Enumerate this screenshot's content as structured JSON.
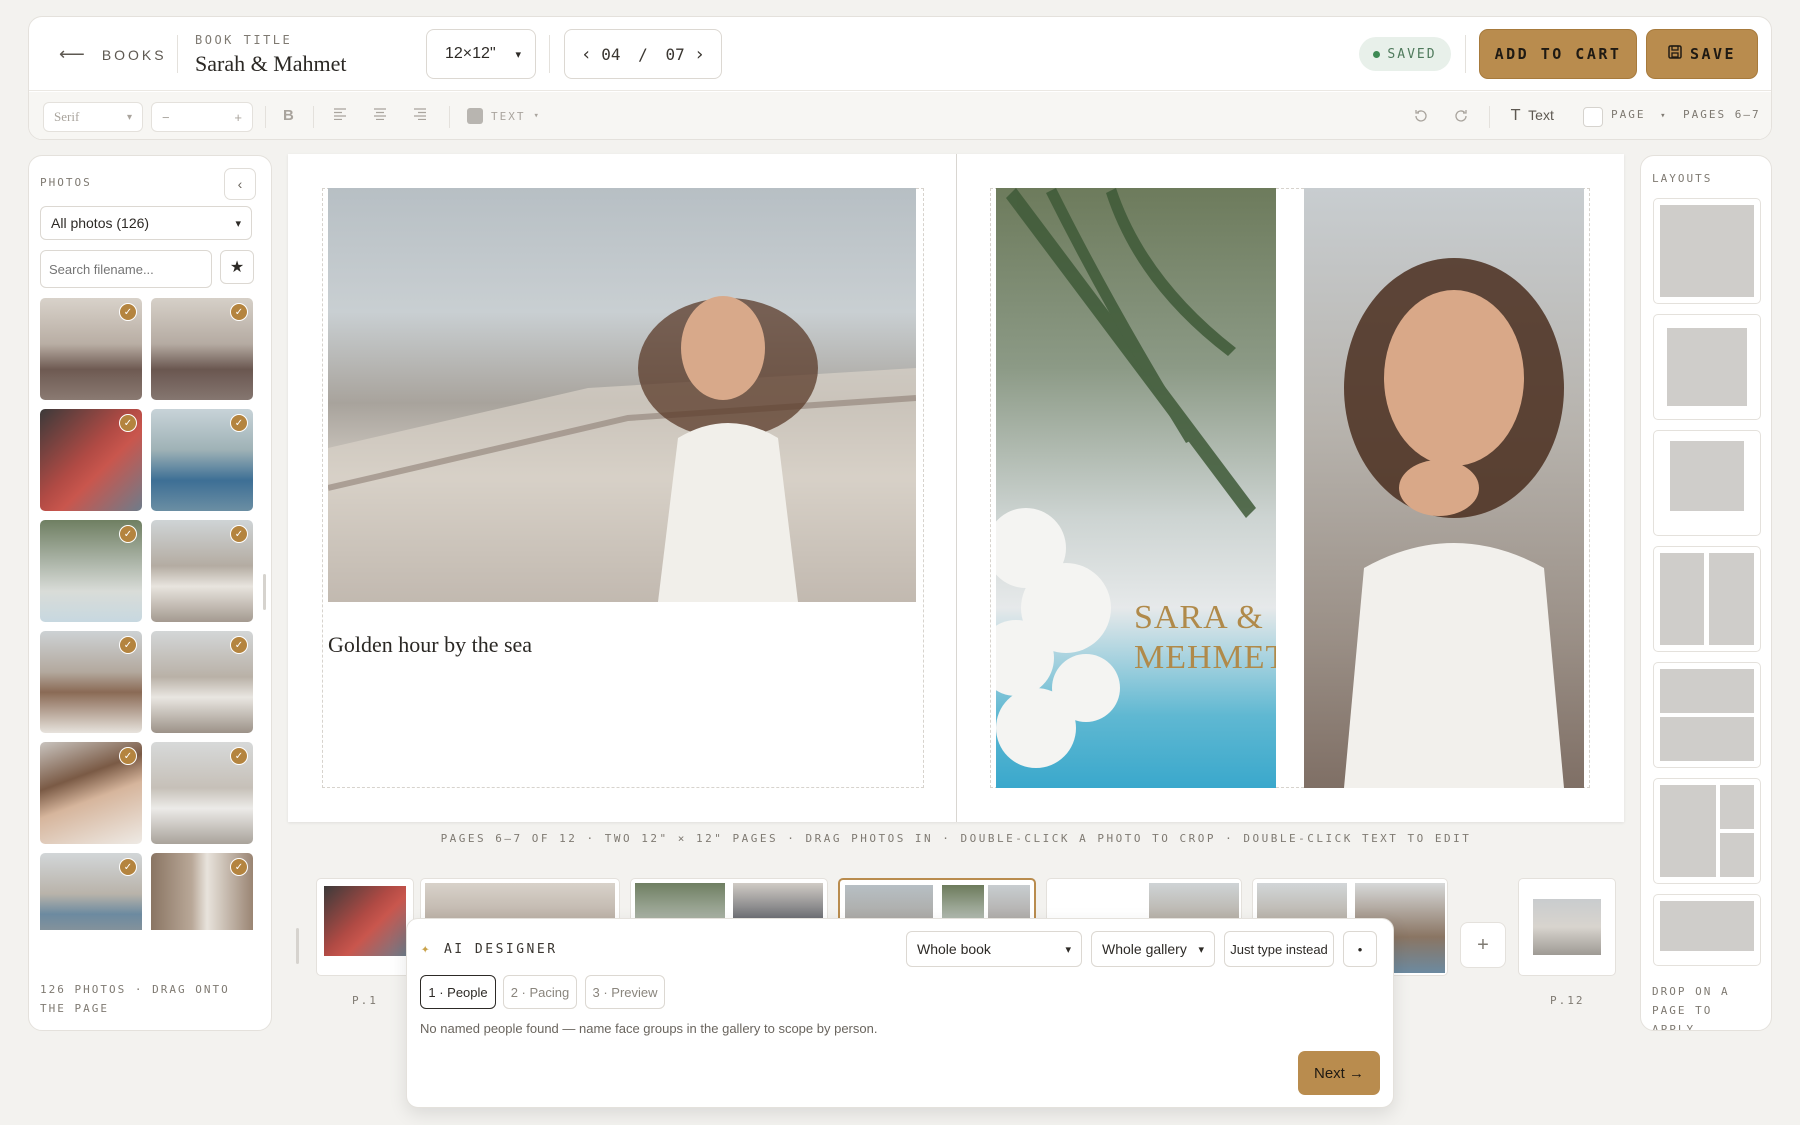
{
  "header": {
    "back_label": "BOOKS",
    "book_title_label": "BOOK TITLE",
    "book_title": "Sarah & Mahmet",
    "size_value": "12×12\"",
    "page_current": "04",
    "page_sep": "/",
    "page_total": "07",
    "saved_label": "SAVED",
    "add_to_cart": "ADD TO CART",
    "save": "SAVE"
  },
  "toolbar": {
    "font_value": "Serif",
    "size_minus": "−",
    "size_plus": "+",
    "bold": "B",
    "text_color_label": "TEXT",
    "text_button": "Text",
    "page_label": "PAGE",
    "pages_label": "PAGES 6–7"
  },
  "photos_panel": {
    "title": "PHOTOS",
    "filter_value": "All photos (126)",
    "search_placeholder": "Search filename...",
    "footer": "126 PHOTOS · DRAG ONTO THE PAGE"
  },
  "canvas": {
    "caption": "Golden hour by the sea",
    "sign_text": "SARA & MEHMET",
    "info": "PAGES 6–7 OF 12 · TWO 12\" × 12\" PAGES · DRAG PHOTOS IN · DOUBLE-CLICK A PHOTO TO CROP · DOUBLE-CLICK TEXT TO EDIT"
  },
  "filmstrip": {
    "first_label": "P.1",
    "last_label": "P.12",
    "add": "+"
  },
  "ai_designer": {
    "title": "AI DESIGNER",
    "scope_value": "Whole book",
    "source_value": "Whole gallery",
    "type_instead": "Just type instead",
    "more": "•",
    "steps": [
      "1 · People",
      "2 · Pacing",
      "3 · Preview"
    ],
    "message": "No named people found — name face groups in the gallery to scope by person.",
    "next": "Next →"
  },
  "layouts_panel": {
    "title": "LAYOUTS",
    "footer": "DROP ON A PAGE TO APPLY"
  },
  "colors": {
    "accent": "#b98c4e",
    "saved_green": "#3e8a54",
    "background": "#f3f2ef"
  }
}
